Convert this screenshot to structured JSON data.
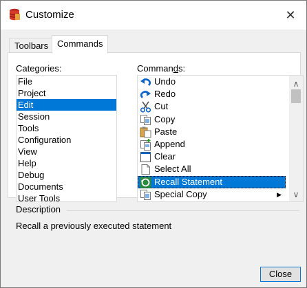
{
  "window": {
    "title": "Customize",
    "close_glyph": "✕"
  },
  "tabs": [
    {
      "label": "Toolbars"
    },
    {
      "label": "Commands"
    }
  ],
  "categories": {
    "label_pre": "Cate",
    "label_u": "g",
    "label_post": "ories:",
    "items": [
      "File",
      "Project",
      "Edit",
      "Session",
      "Tools",
      "Configuration",
      "View",
      "Help",
      "Debug",
      "Documents",
      "User Tools"
    ],
    "selected": "Edit"
  },
  "commands": {
    "label_pre": "Comman",
    "label_u": "d",
    "label_post": "s:",
    "items": [
      {
        "label": "Undo",
        "icon": "undo-icon"
      },
      {
        "label": "Redo",
        "icon": "redo-icon"
      },
      {
        "label": "Cut",
        "icon": "cut-icon"
      },
      {
        "label": "Copy",
        "icon": "copy-icon"
      },
      {
        "label": "Paste",
        "icon": "paste-icon"
      },
      {
        "label": "Append",
        "icon": "append-icon"
      },
      {
        "label": "Clear",
        "icon": "clear-icon"
      },
      {
        "label": "Select All",
        "icon": "select-all-icon"
      },
      {
        "label": "Recall Statement",
        "icon": "recall-icon"
      },
      {
        "label": "Special Copy",
        "icon": "special-copy-icon"
      }
    ],
    "selected": "Recall Statement"
  },
  "description": {
    "title": "Description",
    "text": "Recall a previously executed statement"
  },
  "buttons": {
    "close": "Close"
  },
  "colors": {
    "selection": "#0078d7",
    "accent_icon": "#0a64c8"
  }
}
